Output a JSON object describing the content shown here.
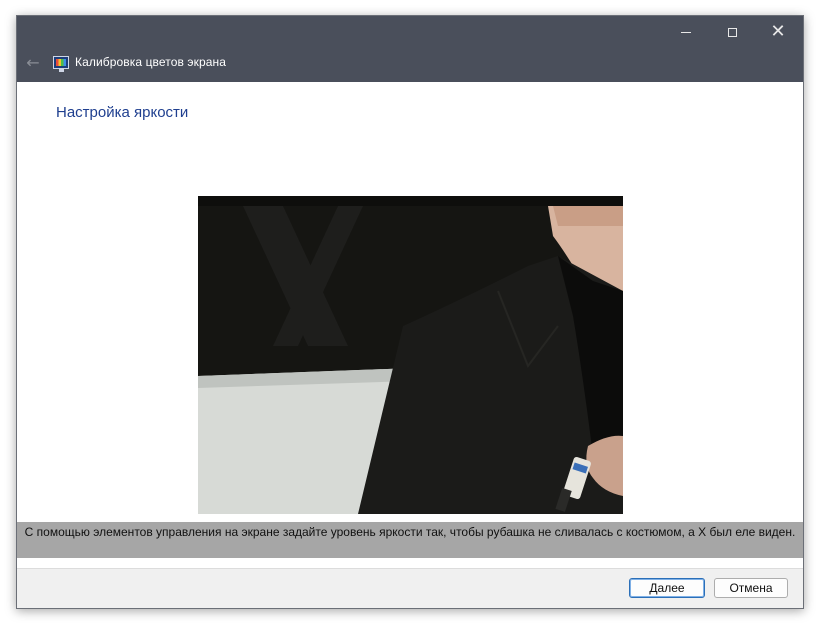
{
  "window": {
    "title": "Калибровка цветов экрана",
    "controls": {
      "minimize": "minimize",
      "maximize": "maximize",
      "close": "✕"
    },
    "back_icon": "←"
  },
  "page": {
    "heading": "Настройка яркости",
    "instructions": "С помощью элементов управления на экране задайте уровень яркости так, чтобы рубашка не сливалась с костюмом, а X был еле виден."
  },
  "footer": {
    "next_accel": "Д",
    "next_rest": "алее",
    "cancel_label": "Отмена"
  },
  "colors": {
    "titlebar": "#4a4f5b",
    "heading": "#1f3f8f",
    "instruction_band": "#a6a6a6",
    "footer": "#f0f0f0",
    "primary_border": "#2b6fb8"
  },
  "icons": {
    "back": "arrow-left-icon",
    "app": "display-color-icon",
    "minimize": "minimize-icon",
    "maximize": "maximize-icon",
    "close": "close-icon"
  }
}
